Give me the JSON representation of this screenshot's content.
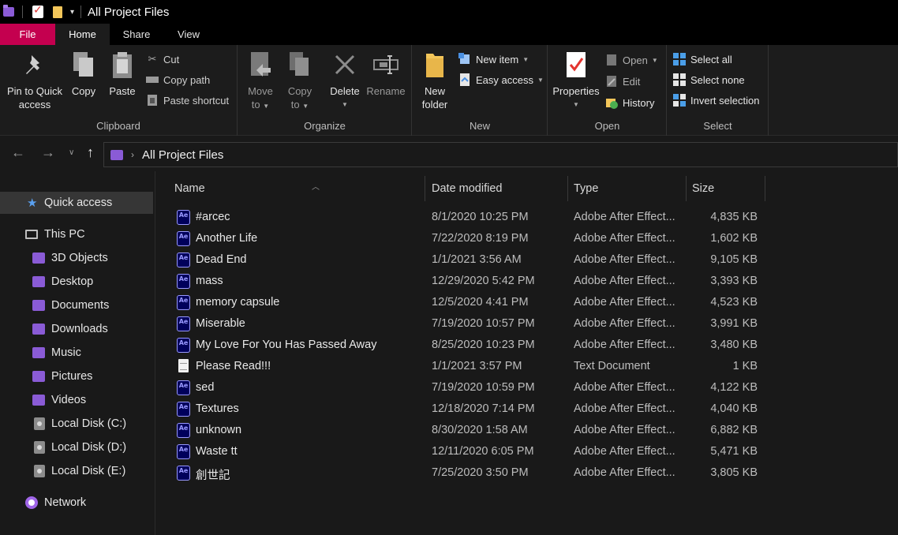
{
  "window": {
    "title": "All Project Files"
  },
  "ribbon_tabs": [
    "File",
    "Home",
    "Share",
    "View"
  ],
  "ribbon": {
    "clipboard": {
      "label": "Clipboard",
      "pin_label_1": "Pin to Quick",
      "pin_label_2": "access",
      "copy": "Copy",
      "paste": "Paste",
      "cut": "Cut",
      "copy_path": "Copy path",
      "paste_shortcut": "Paste shortcut"
    },
    "organize": {
      "label": "Organize",
      "move_1": "Move",
      "move_2": "to",
      "copy_1": "Copy",
      "copy_2": "to",
      "delete": "Delete",
      "rename": "Rename"
    },
    "new": {
      "label": "New",
      "new_folder_1": "New",
      "new_folder_2": "folder",
      "new_item": "New item",
      "easy_access": "Easy access"
    },
    "open": {
      "label": "Open",
      "properties": "Properties",
      "open": "Open",
      "edit": "Edit",
      "history": "History"
    },
    "select": {
      "label": "Select",
      "select_all": "Select all",
      "select_none": "Select none",
      "invert_selection": "Invert selection"
    }
  },
  "address": {
    "path": "All Project Files"
  },
  "nav": {
    "quick_access": "Quick access",
    "this_pc": "This PC",
    "items": [
      "3D Objects",
      "Desktop",
      "Documents",
      "Downloads",
      "Music",
      "Pictures",
      "Videos"
    ],
    "disks": [
      "Local Disk (C:)",
      "Local Disk (D:)",
      "Local Disk (E:)"
    ],
    "network": "Network"
  },
  "columns": {
    "name": "Name",
    "date": "Date modified",
    "type": "Type",
    "size": "Size"
  },
  "files": [
    {
      "name": "#arcec",
      "date": "8/1/2020 10:25 PM",
      "type": "Adobe After Effect...",
      "size": "4,835 KB",
      "icon": "ae"
    },
    {
      "name": "Another Life",
      "date": "7/22/2020 8:19 PM",
      "type": "Adobe After Effect...",
      "size": "1,602 KB",
      "icon": "ae"
    },
    {
      "name": "Dead End",
      "date": "1/1/2021 3:56 AM",
      "type": "Adobe After Effect...",
      "size": "9,105 KB",
      "icon": "ae"
    },
    {
      "name": "mass",
      "date": "12/29/2020 5:42 PM",
      "type": "Adobe After Effect...",
      "size": "3,393 KB",
      "icon": "ae"
    },
    {
      "name": "memory capsule",
      "date": "12/5/2020 4:41 PM",
      "type": "Adobe After Effect...",
      "size": "4,523 KB",
      "icon": "ae"
    },
    {
      "name": "Miserable",
      "date": "7/19/2020 10:57 PM",
      "type": "Adobe After Effect...",
      "size": "3,991 KB",
      "icon": "ae"
    },
    {
      "name": "My Love For You Has Passed Away",
      "date": "8/25/2020 10:23 PM",
      "type": "Adobe After Effect...",
      "size": "3,480 KB",
      "icon": "ae"
    },
    {
      "name": "Please Read!!!",
      "date": "1/1/2021 3:57 PM",
      "type": "Text Document",
      "size": "1 KB",
      "icon": "txt"
    },
    {
      "name": "sed",
      "date": "7/19/2020 10:59 PM",
      "type": "Adobe After Effect...",
      "size": "4,122 KB",
      "icon": "ae"
    },
    {
      "name": "Textures",
      "date": "12/18/2020 7:14 PM",
      "type": "Adobe After Effect...",
      "size": "4,040 KB",
      "icon": "ae"
    },
    {
      "name": "unknown",
      "date": "8/30/2020 1:58 AM",
      "type": "Adobe After Effect...",
      "size": "6,882 KB",
      "icon": "ae"
    },
    {
      "name": "Waste tt",
      "date": "12/11/2020 6:05 PM",
      "type": "Adobe After Effect...",
      "size": "5,471 KB",
      "icon": "ae"
    },
    {
      "name": "創世記",
      "date": "7/25/2020 3:50 PM",
      "type": "Adobe After Effect...",
      "size": "3,805 KB",
      "icon": "ae"
    }
  ],
  "colors": {
    "file_tab": "#c4004f",
    "folder_accent": "#8a5bd6",
    "ae_icon": "#9999ff"
  }
}
